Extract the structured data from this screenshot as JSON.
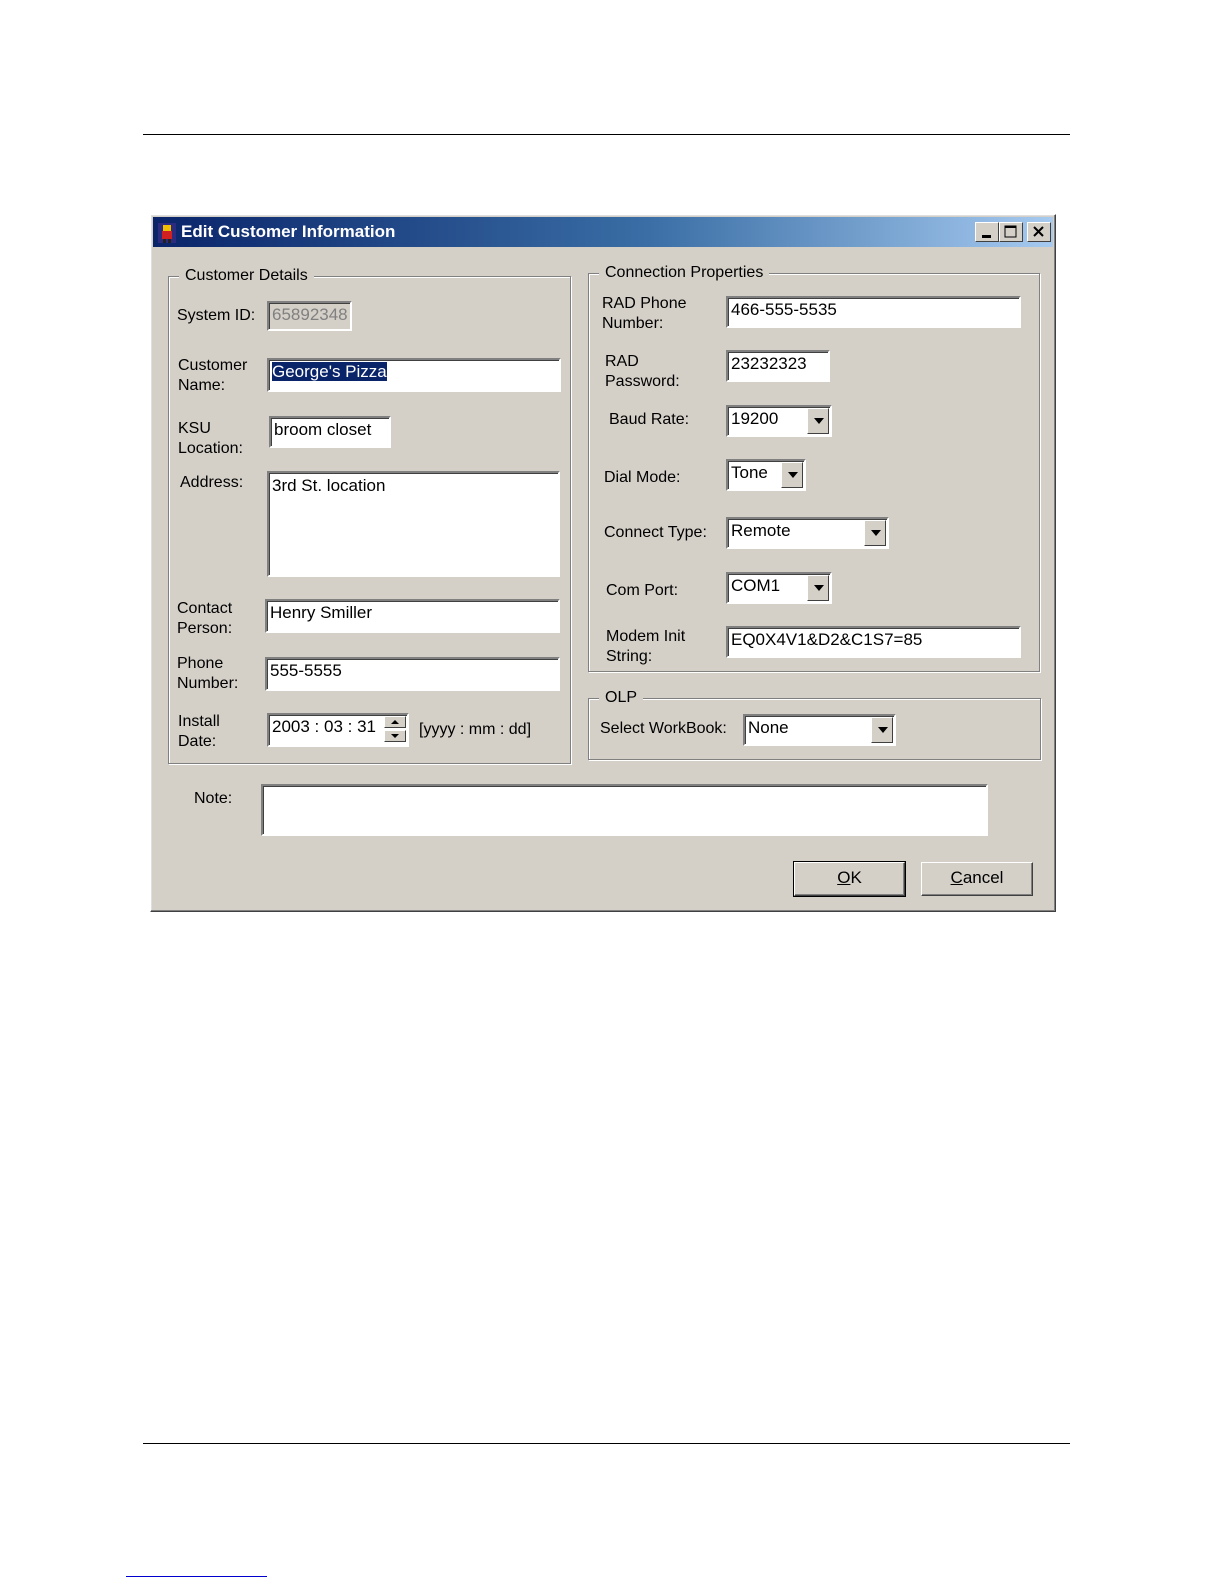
{
  "window": {
    "title": "Edit Customer Information"
  },
  "customer_details": {
    "legend": "Customer Details",
    "system_id": {
      "label": "System ID:",
      "value": "65892348"
    },
    "customer_name": {
      "label_1": "Customer",
      "label_2": "Name:",
      "value": "George's Pizza"
    },
    "ksu_location": {
      "label_1": "KSU",
      "label_2": "Location:",
      "value": "broom closet"
    },
    "address": {
      "label": "Address:",
      "value": "3rd St. location"
    },
    "contact_person": {
      "label_1": "Contact",
      "label_2": "Person:",
      "value": "Henry Smiller"
    },
    "phone_number": {
      "label_1": "Phone",
      "label_2": "Number:",
      "value": "555-5555"
    },
    "install_date": {
      "label_1": "Install",
      "label_2": "Date:",
      "value": "2003 : 03 : 31",
      "format": "[yyyy : mm : dd]"
    }
  },
  "connection_properties": {
    "legend": "Connection Properties",
    "rad_phone": {
      "label_1": "RAD Phone",
      "label_2": "Number:",
      "value": "466-555-5535"
    },
    "rad_password": {
      "label_1": "RAD",
      "label_2": "Password:",
      "value": "23232323"
    },
    "baud_rate": {
      "label": "Baud Rate:",
      "value": "19200"
    },
    "dial_mode": {
      "label": "Dial Mode:",
      "value": "Tone"
    },
    "connect_type": {
      "label": "Connect Type:",
      "value": "Remote"
    },
    "com_port": {
      "label": "Com Port:",
      "value": "COM1"
    },
    "modem_init": {
      "label_1": "Modem Init",
      "label_2": "String:",
      "value": "EQ0X4V1&D2&C1S7=85"
    }
  },
  "olp": {
    "legend": "OLP",
    "workbook": {
      "label": "Select WorkBook:",
      "value": "None"
    }
  },
  "note": {
    "label": "Note:",
    "value": ""
  },
  "buttons": {
    "ok_underline": "O",
    "ok_rest": "K",
    "cancel_underline": "C",
    "cancel_rest": "ancel"
  }
}
